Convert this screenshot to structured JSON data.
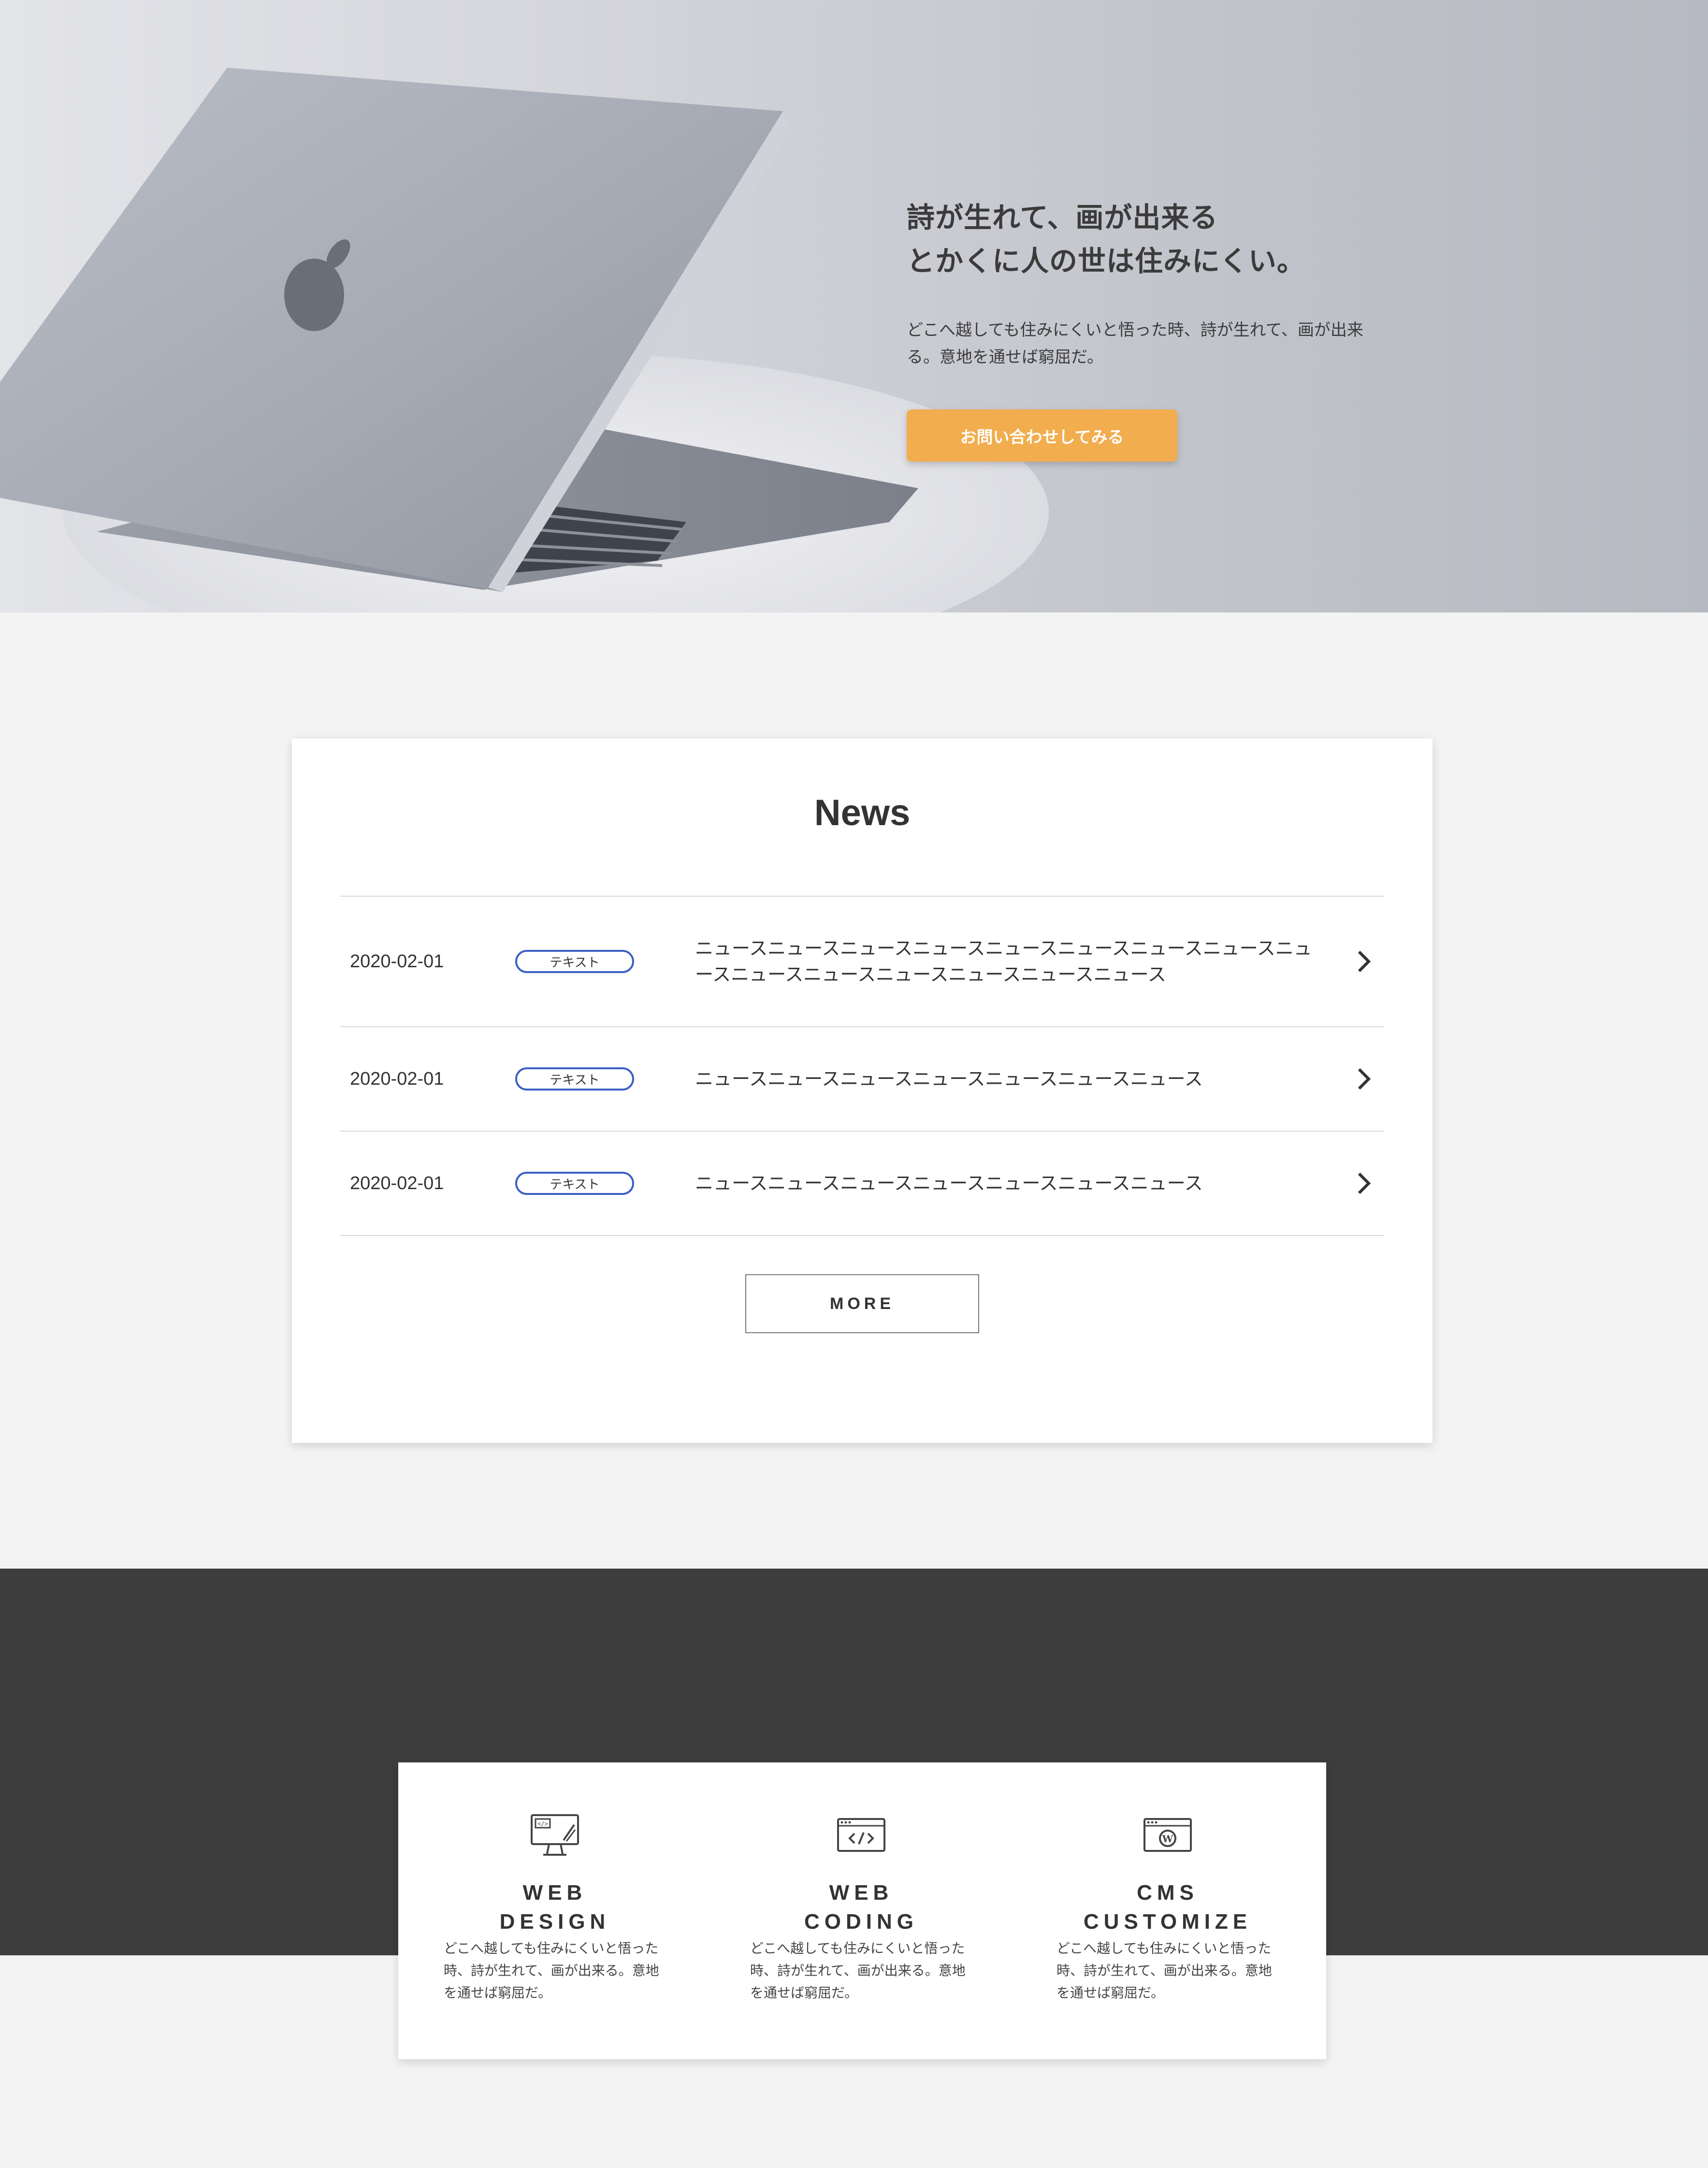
{
  "hero": {
    "title_line1": "詩が生れて、画が出来る",
    "title_line2": "とかくに人の世は住みにくい。",
    "text": "どこへ越しても住みにくいと悟った時、詩が生れて、画が出来る。意地を通せば窮屈だ。",
    "cta_label": "お問い合わせしてみる",
    "cta_color": "#f2ad4e"
  },
  "news": {
    "title": "News",
    "items": [
      {
        "date": "2020-02-01",
        "tag": "テキスト",
        "text": "ニュースニュースニュースニュースニュースニュースニュースニュースニュースニュースニュースニュースニュースニュースニュース"
      },
      {
        "date": "2020-02-01",
        "tag": "テキスト",
        "text": "ニュースニュースニュースニュースニュースニュースニュース"
      },
      {
        "date": "2020-02-01",
        "tag": "テキスト",
        "text": "ニュースニュースニュースニュースニュースニュースニュース"
      }
    ],
    "more_label": "MORE",
    "tag_color": "#3b5fc4",
    "arrow_icon": "chevron-right-icon"
  },
  "services": {
    "items": [
      {
        "name_line1": "WEB",
        "name_line2": "DESIGN",
        "icon": "monitor-design-icon",
        "text": "どこへ越しても住みにくいと悟った時、詩が生れて、画が出来る。意地を通せば窮屈だ。"
      },
      {
        "name_line1": "WEB",
        "name_line2": "CODING",
        "icon": "code-window-icon",
        "text": "どこへ越しても住みにくいと悟った時、詩が生れて、画が出来る。意地を通せば窮屈だ。"
      },
      {
        "name_line1": "CMS",
        "name_line2": "CUSTOMIZE",
        "icon": "wordpress-window-icon",
        "text": "どこへ越しても住みにくいと悟った時、詩が生れて、画が出来る。意地を通せば窮屈だ。"
      }
    ]
  },
  "colors": {
    "page_background": "#f3f3f3",
    "dark_band": "#3d3d3d",
    "text": "#333333"
  }
}
